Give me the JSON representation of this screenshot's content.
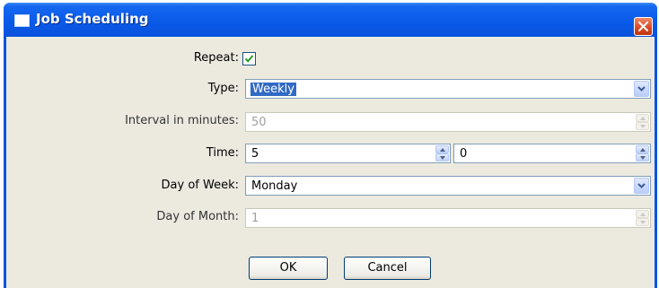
{
  "window": {
    "title": "Job Scheduling"
  },
  "form": {
    "repeat": {
      "label": "Repeat:",
      "checked": true
    },
    "type": {
      "label": "Type:",
      "value": "Weekly"
    },
    "interval": {
      "label": "Interval in minutes:",
      "value": "50",
      "enabled": false
    },
    "time": {
      "label": "Time:",
      "hour": "5",
      "minute": "0"
    },
    "day_of_week": {
      "label": "Day of Week:",
      "value": "Monday"
    },
    "day_of_month": {
      "label": "Day of Month:",
      "value": "1",
      "enabled": false
    }
  },
  "buttons": {
    "ok": "OK",
    "cancel": "Cancel"
  },
  "colors": {
    "titlebar": "#0a5ae8",
    "background": "#eceadf",
    "selection": "#316ac5",
    "close": "#d9461f"
  }
}
